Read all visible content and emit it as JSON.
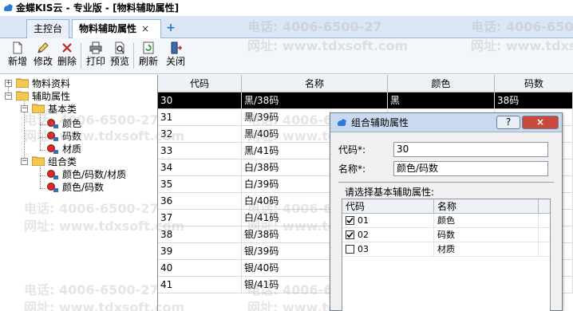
{
  "title": "金蝶KIS云 - 专业版 - [物料辅助属性]",
  "tabs": [
    {
      "label": "主控台",
      "active": false
    },
    {
      "label": "物料辅助属性",
      "active": true,
      "close": "×"
    }
  ],
  "tab_add": "+",
  "toolbar": {
    "new": "新增",
    "edit": "修改",
    "delete": "删除",
    "print": "打印",
    "preview": "预览",
    "refresh": "刷新",
    "close": "关闭"
  },
  "tree": {
    "root1": "物料资料",
    "root2": "辅助属性",
    "basic": "基本类",
    "basic_items": [
      "颜色",
      "码数",
      "材质"
    ],
    "combo": "组合类",
    "combo_items": [
      "颜色/码数/材质",
      "颜色/码数"
    ],
    "expand_symbol_plus": "+",
    "expand_symbol_minus": "−"
  },
  "grid": {
    "headers": [
      "代码",
      "名称",
      "颜色",
      "码数"
    ],
    "rows": [
      {
        "code": "30",
        "name": "黑/38码",
        "color": "黑",
        "size": "38码"
      },
      {
        "code": "31",
        "name": "黑/39码",
        "color": "",
        "size": ""
      },
      {
        "code": "32",
        "name": "黑/40码",
        "color": "",
        "size": ""
      },
      {
        "code": "33",
        "name": "黑/41码",
        "color": "",
        "size": ""
      },
      {
        "code": "34",
        "name": "白/38码",
        "color": "",
        "size": ""
      },
      {
        "code": "35",
        "name": "白/39码",
        "color": "",
        "size": ""
      },
      {
        "code": "36",
        "name": "白/40码",
        "color": "",
        "size": ""
      },
      {
        "code": "37",
        "name": "白/41码",
        "color": "",
        "size": ""
      },
      {
        "code": "38",
        "name": "银/38码",
        "color": "",
        "size": ""
      },
      {
        "code": "39",
        "name": "银/39码",
        "color": "",
        "size": ""
      },
      {
        "code": "40",
        "name": "银/40码",
        "color": "",
        "size": ""
      },
      {
        "code": "41",
        "name": "银/41码",
        "color": "",
        "size": ""
      }
    ]
  },
  "dialog": {
    "title": "组合辅助属性",
    "help": "?",
    "close": "×",
    "code_label": "代码*:",
    "code_value": "30",
    "name_label": "名称*:",
    "name_value": "颜色/码数",
    "section_label": "请选择基本辅助属性:",
    "sub_headers": [
      "代码",
      "名称"
    ],
    "sub_rows": [
      {
        "checked": true,
        "code": "01",
        "name": "颜色"
      },
      {
        "checked": true,
        "code": "02",
        "name": "码数"
      },
      {
        "checked": false,
        "code": "03",
        "name": "材质"
      }
    ]
  },
  "watermarks": {
    "phone": "电话: 4006-6500-27",
    "site": "网址: www.tdxsoft.com"
  },
  "colors": {
    "selected_row_bg": "#000000",
    "tab_bar_bg": "#dbe7f5",
    "dialog_title_bg": "#c9daf0",
    "close_button": "#c94a3c"
  }
}
